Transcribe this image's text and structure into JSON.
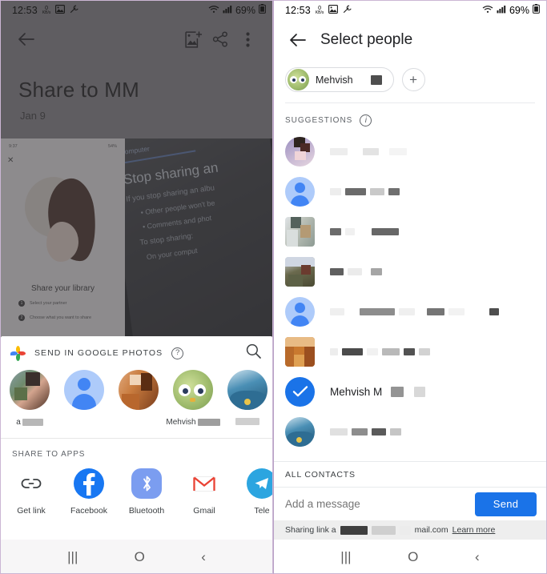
{
  "left_screen": {
    "status_bar": {
      "clock": "12:53",
      "data_rate": "0",
      "data_unit": "KB/s",
      "battery": "69%",
      "icons": [
        "data-usage-icon",
        "image-icon",
        "wrench-icon",
        "wifi-icon",
        "signal-icon",
        "battery-icon"
      ]
    },
    "toolbar": {
      "back_icon": "back-arrow-icon",
      "add_photos_icon": "add-photo-icon",
      "share_icon": "share-icon",
      "overflow_icon": "more-vertical-icon"
    },
    "album": {
      "title": "Share to MM",
      "date": "Jan 9"
    },
    "thumb_a": {
      "status_left": "9:37",
      "status_right": "54%",
      "close_icon": "close-icon",
      "caption": "Share your library",
      "steps": [
        "Select your partner",
        "Choose what you want to share"
      ]
    },
    "thumb_b": {
      "kicker": "Computer",
      "heading": "Stop sharing an",
      "line1": "If you stop sharing an albu",
      "bullet1": "Other people won't be",
      "bullet2": "Comments and phot",
      "line2": "To stop sharing:",
      "line3": "On your comput"
    },
    "share_sheet": {
      "title": "SEND IN GOOGLE PHOTOS",
      "help_icon": "help-circle-icon",
      "search_icon": "search-icon",
      "people": [
        {
          "name_visible": "a",
          "redacted": true,
          "avatar": "photo-avatar"
        },
        {
          "name_visible": "",
          "redacted": false,
          "avatar": "default-person-avatar"
        },
        {
          "name_visible": "",
          "redacted": false,
          "avatar": "photo-avatar"
        },
        {
          "name_visible": "Mehvish",
          "redacted": true,
          "avatar": "bird-avatar"
        },
        {
          "name_visible": "",
          "redacted": true,
          "avatar": "ocean-avatar"
        }
      ],
      "apps_label": "SHARE TO APPS",
      "apps": [
        {
          "label": "Get link",
          "icon": "link-icon"
        },
        {
          "label": "Facebook",
          "icon": "facebook-icon"
        },
        {
          "label": "Bluetooth",
          "icon": "bluetooth-icon"
        },
        {
          "label": "Gmail",
          "icon": "gmail-icon"
        },
        {
          "label": "Tele",
          "icon": "telegram-icon"
        }
      ]
    },
    "nav_bar": {
      "recents": "|||",
      "home": "O",
      "back": "‹"
    }
  },
  "right_screen": {
    "status_bar": {
      "clock": "12:53",
      "data_rate": "0",
      "data_unit": "KB/s",
      "battery": "69%"
    },
    "header": {
      "back_icon": "back-arrow-icon",
      "title": "Select people"
    },
    "chip": {
      "name": "Mehvish",
      "redacted_suffix": true,
      "avatar": "bird-avatar"
    },
    "add_button_icon": "plus-icon",
    "suggestions_label": "SUGGESTIONS",
    "info_icon": "info-circle-icon",
    "contacts": [
      {
        "name": "",
        "redacted": true,
        "avatar": "photo-purple",
        "selected": false
      },
      {
        "name": "",
        "redacted": true,
        "avatar": "default-person-avatar",
        "selected": false
      },
      {
        "name": "",
        "redacted": true,
        "avatar": "photo-grey",
        "selected": false
      },
      {
        "name": "",
        "redacted": true,
        "avatar": "photo-olive",
        "selected": false
      },
      {
        "name": "",
        "redacted": true,
        "avatar": "default-person-avatar",
        "selected": false
      },
      {
        "name": "",
        "redacted": true,
        "avatar": "box-orange",
        "selected": false
      },
      {
        "name": "Mehvish M",
        "redacted": true,
        "avatar": "check-circle",
        "selected": true
      },
      {
        "name": "",
        "redacted": true,
        "avatar": "ocean-avatar",
        "selected": false
      }
    ],
    "all_contacts_label": "ALL CONTACTS",
    "message": {
      "placeholder": "Add a message",
      "value": ""
    },
    "send_label": "Send",
    "link_bar": {
      "prefix": "Sharing link a",
      "suffix": "mail.com",
      "learn_more": "Learn more"
    },
    "annotation": {
      "type": "arrow",
      "color": "#c06ad8",
      "points_to": "Mehvish M row"
    },
    "nav_bar": {
      "recents": "|||",
      "home": "O",
      "back": "‹"
    }
  },
  "colors": {
    "accent_blue": "#1a73e8",
    "arrow_purple": "#c06ad8",
    "text_primary": "#202124",
    "text_secondary": "#5f6368",
    "dim_overlay": "#8c8a8d"
  }
}
